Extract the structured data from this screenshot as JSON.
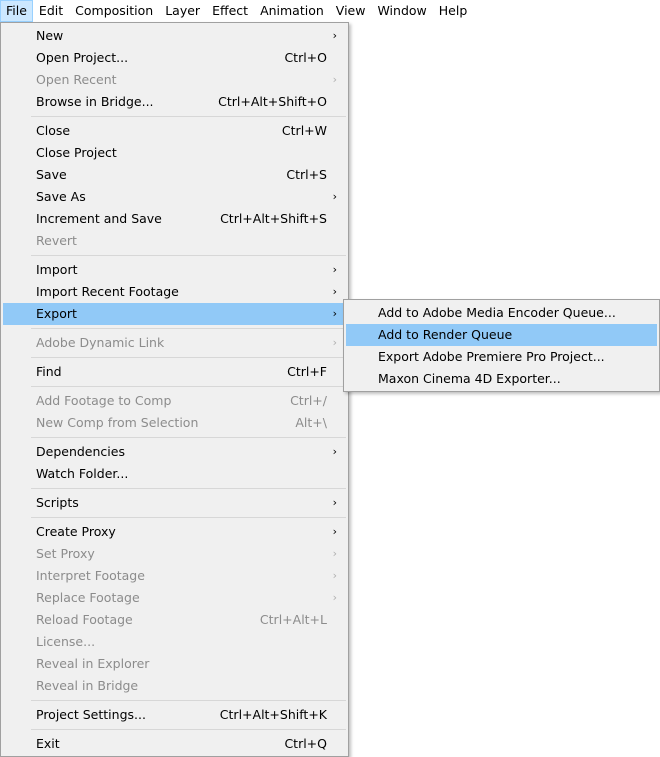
{
  "menubar": {
    "items": [
      "File",
      "Edit",
      "Composition",
      "Layer",
      "Effect",
      "Animation",
      "View",
      "Window",
      "Help"
    ]
  },
  "file_menu": {
    "new": {
      "label": "New",
      "shortcut": ""
    },
    "open_project": {
      "label": "Open Project...",
      "shortcut": "Ctrl+O"
    },
    "open_recent": {
      "label": "Open Recent",
      "shortcut": ""
    },
    "browse_in_bridge": {
      "label": "Browse in Bridge...",
      "shortcut": "Ctrl+Alt+Shift+O"
    },
    "close": {
      "label": "Close",
      "shortcut": "Ctrl+W"
    },
    "close_project": {
      "label": "Close Project",
      "shortcut": ""
    },
    "save": {
      "label": "Save",
      "shortcut": "Ctrl+S"
    },
    "save_as": {
      "label": "Save As",
      "shortcut": ""
    },
    "increment_and_save": {
      "label": "Increment and Save",
      "shortcut": "Ctrl+Alt+Shift+S"
    },
    "revert": {
      "label": "Revert",
      "shortcut": ""
    },
    "import": {
      "label": "Import",
      "shortcut": ""
    },
    "import_recent_footage": {
      "label": "Import Recent Footage",
      "shortcut": ""
    },
    "export": {
      "label": "Export",
      "shortcut": ""
    },
    "adobe_dynamic_link": {
      "label": "Adobe Dynamic Link",
      "shortcut": ""
    },
    "find": {
      "label": "Find",
      "shortcut": "Ctrl+F"
    },
    "add_footage_to_comp": {
      "label": "Add Footage to Comp",
      "shortcut": "Ctrl+/"
    },
    "new_comp_from_selection": {
      "label": "New Comp from Selection",
      "shortcut": "Alt+\\"
    },
    "dependencies": {
      "label": "Dependencies",
      "shortcut": ""
    },
    "watch_folder": {
      "label": "Watch Folder...",
      "shortcut": ""
    },
    "scripts": {
      "label": "Scripts",
      "shortcut": ""
    },
    "create_proxy": {
      "label": "Create Proxy",
      "shortcut": ""
    },
    "set_proxy": {
      "label": "Set Proxy",
      "shortcut": ""
    },
    "interpret_footage": {
      "label": "Interpret Footage",
      "shortcut": ""
    },
    "replace_footage": {
      "label": "Replace Footage",
      "shortcut": ""
    },
    "reload_footage": {
      "label": "Reload Footage",
      "shortcut": "Ctrl+Alt+L"
    },
    "license": {
      "label": "License...",
      "shortcut": ""
    },
    "reveal_in_explorer": {
      "label": "Reveal in Explorer",
      "shortcut": ""
    },
    "reveal_in_bridge": {
      "label": "Reveal in Bridge",
      "shortcut": ""
    },
    "project_settings": {
      "label": "Project Settings...",
      "shortcut": "Ctrl+Alt+Shift+K"
    },
    "exit": {
      "label": "Exit",
      "shortcut": "Ctrl+Q"
    }
  },
  "export_submenu": {
    "items": [
      "Add to Adobe Media Encoder Queue...",
      "Add to Render Queue",
      "Export Adobe Premiere Pro Project...",
      "Maxon Cinema 4D Exporter..."
    ]
  },
  "icons": {
    "submenu_arrow": "chevron-right-icon"
  },
  "colors": {
    "menu_background": "#f0f0f0",
    "highlight": "#91c9f7",
    "menubar_active": "#cce8ff",
    "disabled_text": "#8c8c8c"
  }
}
